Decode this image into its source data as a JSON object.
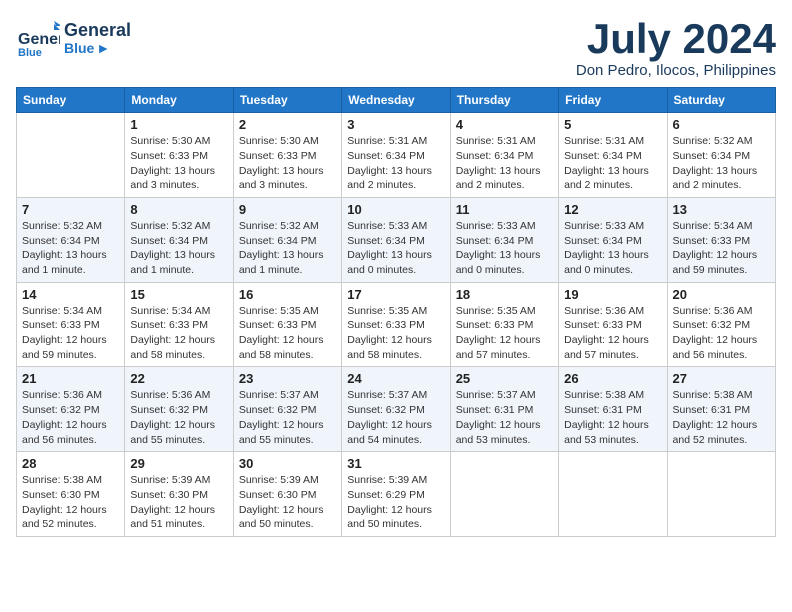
{
  "header": {
    "logo_line1": "General",
    "logo_line2": "Blue",
    "month_title": "July 2024",
    "location": "Don Pedro, Ilocos, Philippines"
  },
  "weekdays": [
    "Sunday",
    "Monday",
    "Tuesday",
    "Wednesday",
    "Thursday",
    "Friday",
    "Saturday"
  ],
  "weeks": [
    [
      {
        "day": "",
        "info": ""
      },
      {
        "day": "1",
        "info": "Sunrise: 5:30 AM\nSunset: 6:33 PM\nDaylight: 13 hours\nand 3 minutes."
      },
      {
        "day": "2",
        "info": "Sunrise: 5:30 AM\nSunset: 6:33 PM\nDaylight: 13 hours\nand 3 minutes."
      },
      {
        "day": "3",
        "info": "Sunrise: 5:31 AM\nSunset: 6:34 PM\nDaylight: 13 hours\nand 2 minutes."
      },
      {
        "day": "4",
        "info": "Sunrise: 5:31 AM\nSunset: 6:34 PM\nDaylight: 13 hours\nand 2 minutes."
      },
      {
        "day": "5",
        "info": "Sunrise: 5:31 AM\nSunset: 6:34 PM\nDaylight: 13 hours\nand 2 minutes."
      },
      {
        "day": "6",
        "info": "Sunrise: 5:32 AM\nSunset: 6:34 PM\nDaylight: 13 hours\nand 2 minutes."
      }
    ],
    [
      {
        "day": "7",
        "info": "Sunrise: 5:32 AM\nSunset: 6:34 PM\nDaylight: 13 hours\nand 1 minute."
      },
      {
        "day": "8",
        "info": "Sunrise: 5:32 AM\nSunset: 6:34 PM\nDaylight: 13 hours\nand 1 minute."
      },
      {
        "day": "9",
        "info": "Sunrise: 5:32 AM\nSunset: 6:34 PM\nDaylight: 13 hours\nand 1 minute."
      },
      {
        "day": "10",
        "info": "Sunrise: 5:33 AM\nSunset: 6:34 PM\nDaylight: 13 hours\nand 0 minutes."
      },
      {
        "day": "11",
        "info": "Sunrise: 5:33 AM\nSunset: 6:34 PM\nDaylight: 13 hours\nand 0 minutes."
      },
      {
        "day": "12",
        "info": "Sunrise: 5:33 AM\nSunset: 6:34 PM\nDaylight: 13 hours\nand 0 minutes."
      },
      {
        "day": "13",
        "info": "Sunrise: 5:34 AM\nSunset: 6:33 PM\nDaylight: 12 hours\nand 59 minutes."
      }
    ],
    [
      {
        "day": "14",
        "info": "Sunrise: 5:34 AM\nSunset: 6:33 PM\nDaylight: 12 hours\nand 59 minutes."
      },
      {
        "day": "15",
        "info": "Sunrise: 5:34 AM\nSunset: 6:33 PM\nDaylight: 12 hours\nand 58 minutes."
      },
      {
        "day": "16",
        "info": "Sunrise: 5:35 AM\nSunset: 6:33 PM\nDaylight: 12 hours\nand 58 minutes."
      },
      {
        "day": "17",
        "info": "Sunrise: 5:35 AM\nSunset: 6:33 PM\nDaylight: 12 hours\nand 58 minutes."
      },
      {
        "day": "18",
        "info": "Sunrise: 5:35 AM\nSunset: 6:33 PM\nDaylight: 12 hours\nand 57 minutes."
      },
      {
        "day": "19",
        "info": "Sunrise: 5:36 AM\nSunset: 6:33 PM\nDaylight: 12 hours\nand 57 minutes."
      },
      {
        "day": "20",
        "info": "Sunrise: 5:36 AM\nSunset: 6:32 PM\nDaylight: 12 hours\nand 56 minutes."
      }
    ],
    [
      {
        "day": "21",
        "info": "Sunrise: 5:36 AM\nSunset: 6:32 PM\nDaylight: 12 hours\nand 56 minutes."
      },
      {
        "day": "22",
        "info": "Sunrise: 5:36 AM\nSunset: 6:32 PM\nDaylight: 12 hours\nand 55 minutes."
      },
      {
        "day": "23",
        "info": "Sunrise: 5:37 AM\nSunset: 6:32 PM\nDaylight: 12 hours\nand 55 minutes."
      },
      {
        "day": "24",
        "info": "Sunrise: 5:37 AM\nSunset: 6:32 PM\nDaylight: 12 hours\nand 54 minutes."
      },
      {
        "day": "25",
        "info": "Sunrise: 5:37 AM\nSunset: 6:31 PM\nDaylight: 12 hours\nand 53 minutes."
      },
      {
        "day": "26",
        "info": "Sunrise: 5:38 AM\nSunset: 6:31 PM\nDaylight: 12 hours\nand 53 minutes."
      },
      {
        "day": "27",
        "info": "Sunrise: 5:38 AM\nSunset: 6:31 PM\nDaylight: 12 hours\nand 52 minutes."
      }
    ],
    [
      {
        "day": "28",
        "info": "Sunrise: 5:38 AM\nSunset: 6:30 PM\nDaylight: 12 hours\nand 52 minutes."
      },
      {
        "day": "29",
        "info": "Sunrise: 5:39 AM\nSunset: 6:30 PM\nDaylight: 12 hours\nand 51 minutes."
      },
      {
        "day": "30",
        "info": "Sunrise: 5:39 AM\nSunset: 6:30 PM\nDaylight: 12 hours\nand 50 minutes."
      },
      {
        "day": "31",
        "info": "Sunrise: 5:39 AM\nSunset: 6:29 PM\nDaylight: 12 hours\nand 50 minutes."
      },
      {
        "day": "",
        "info": ""
      },
      {
        "day": "",
        "info": ""
      },
      {
        "day": "",
        "info": ""
      }
    ]
  ]
}
